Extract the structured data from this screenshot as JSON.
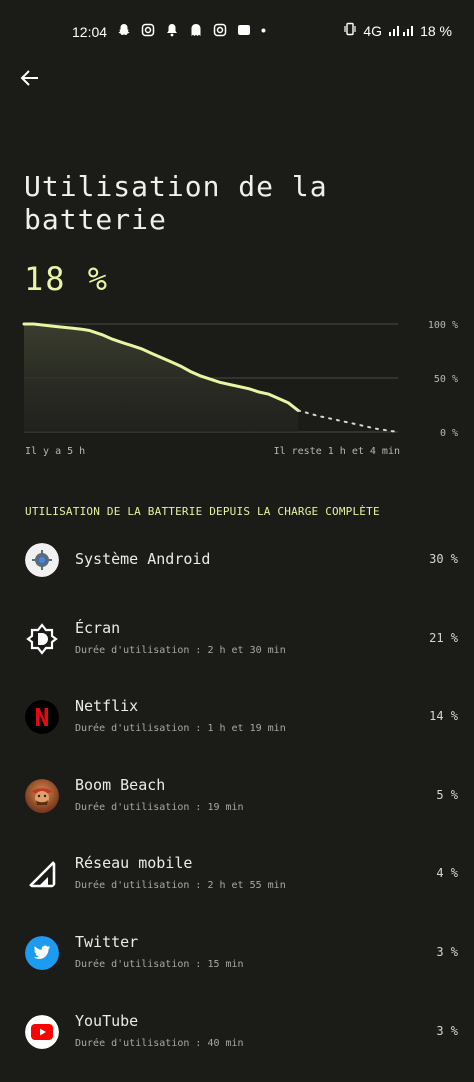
{
  "status_bar": {
    "time": "12:04",
    "network": "4G",
    "battery": "18 %"
  },
  "page": {
    "title": "Utilisation de la batterie",
    "battery_level": "18 %"
  },
  "chart_data": {
    "type": "area",
    "x_labels": [
      "Il y a 5 h",
      "Il reste 1 h et 4 min"
    ],
    "y_ticks": [
      "100 %",
      "50 %",
      "0 %"
    ],
    "ylim": [
      0,
      100
    ],
    "series": [
      {
        "x": [
          0,
          0.15,
          0.3,
          0.45,
          0.6,
          0.75,
          0.9,
          1.0,
          1.2,
          1.35,
          1.5,
          1.65,
          1.8,
          1.95,
          2.1,
          2.25,
          2.4,
          2.55,
          2.7,
          2.85,
          3.0,
          3.15,
          3.3,
          3.45,
          3.6,
          3.75,
          3.9,
          4.05,
          4.2
        ],
        "values": [
          100,
          100,
          99,
          98,
          97,
          96,
          95,
          94,
          90,
          86,
          83,
          80,
          77,
          73,
          69,
          65,
          61,
          56,
          52,
          49,
          46,
          44,
          42,
          40,
          37,
          35,
          31,
          27,
          20
        ]
      },
      {
        "x": [
          4.2,
          4.5,
          4.8,
          5.1,
          5.4,
          5.73
        ],
        "values": [
          20,
          15,
          11,
          7,
          3,
          0
        ]
      }
    ]
  },
  "section_title": "UTILISATION DE LA BATTERIE DEPUIS LA CHARGE COMPLÈTE",
  "apps": [
    {
      "name": "Système Android",
      "sub": "",
      "pct": "30 %",
      "icon": "android-system-icon"
    },
    {
      "name": "Écran",
      "sub": "Durée d'utilisation : 2 h et 30 min",
      "pct": "21 %",
      "icon": "screen-brightness-icon"
    },
    {
      "name": "Netflix",
      "sub": "Durée d'utilisation : 1 h et 19 min",
      "pct": "14 %",
      "icon": "netflix-icon"
    },
    {
      "name": "Boom Beach",
      "sub": "Durée d'utilisation : 19 min",
      "pct": "5 %",
      "icon": "boom-beach-icon"
    },
    {
      "name": "Réseau mobile",
      "sub": "Durée d'utilisation : 2 h et 55 min",
      "pct": "4 %",
      "icon": "cellular-signal-icon"
    },
    {
      "name": "Twitter",
      "sub": "Durée d'utilisation : 15 min",
      "pct": "3 %",
      "icon": "twitter-icon"
    },
    {
      "name": "YouTube",
      "sub": "Durée d'utilisation : 40 min",
      "pct": "3 %",
      "icon": "youtube-icon"
    }
  ],
  "colors": {
    "background": "#1b1b18",
    "accent": "#e4f3a0",
    "netflix": "#e50914",
    "twitter": "#1d9bf0",
    "youtube": "#ff0000"
  }
}
